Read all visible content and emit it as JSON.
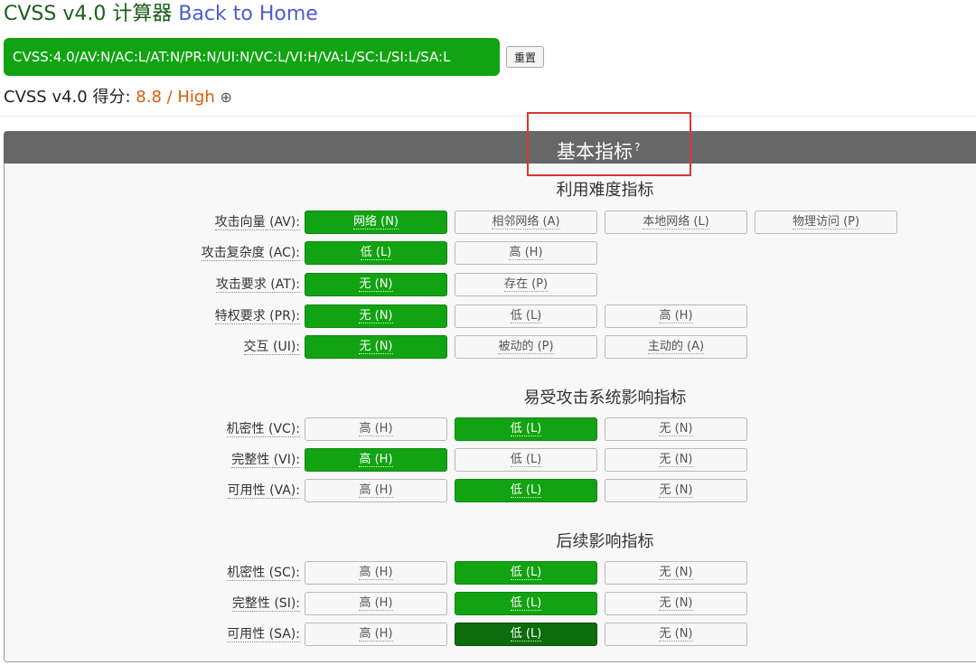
{
  "header": {
    "app_title": "CVSS v4.0 计算器",
    "home_link": "Back to Home"
  },
  "vector": {
    "string": "CVSS:4.0/AV:N/AC:L/AT:N/PR:N/UI:N/VC:L/VI:H/VA:L/SC:L/SI:L/SA:L",
    "reset_label": "重置"
  },
  "score": {
    "prefix": "CVSS v4.0 得分:",
    "value": "8.8 / High",
    "expand_symbol": "⊕"
  },
  "panel": {
    "title": "基本指标",
    "help_mark": "?"
  },
  "sections": {
    "exploitability": {
      "title": "利用难度指标",
      "metrics": {
        "av": {
          "label": "攻击向量 (AV):",
          "options": [
            "网络 (N)",
            "相邻网络 (A)",
            "本地网络 (L)",
            "物理访问 (P)"
          ],
          "selected": 0
        },
        "ac": {
          "label": "攻击复杂度 (AC):",
          "options": [
            "低 (L)",
            "高 (H)"
          ],
          "selected": 0
        },
        "at": {
          "label": "攻击要求 (AT):",
          "options": [
            "无 (N)",
            "存在 (P)"
          ],
          "selected": 0
        },
        "pr": {
          "label": "特权要求 (PR):",
          "options": [
            "无 (N)",
            "低 (L)",
            "高 (H)"
          ],
          "selected": 0
        },
        "ui": {
          "label": "交互 (UI):",
          "options": [
            "无 (N)",
            "被动的 (P)",
            "主动的 (A)"
          ],
          "selected": 0
        }
      }
    },
    "vulnerable": {
      "title": "易受攻击系统影响指标",
      "metrics": {
        "vc": {
          "label": "机密性 (VC):",
          "options": [
            "高 (H)",
            "低 (L)",
            "无 (N)"
          ],
          "selected": 1
        },
        "vi": {
          "label": "完整性 (VI):",
          "options": [
            "高 (H)",
            "低 (L)",
            "无 (N)"
          ],
          "selected": 0
        },
        "va": {
          "label": "可用性 (VA):",
          "options": [
            "高 (H)",
            "低 (L)",
            "无 (N)"
          ],
          "selected": 1
        }
      }
    },
    "subsequent": {
      "title": "后续影响指标",
      "metrics": {
        "sc": {
          "label": "机密性 (SC):",
          "options": [
            "高 (H)",
            "低 (L)",
            "无 (N)"
          ],
          "selected": 1
        },
        "si": {
          "label": "完整性 (SI):",
          "options": [
            "高 (H)",
            "低 (L)",
            "无 (N)"
          ],
          "selected": 1
        },
        "sa": {
          "label": "可用性 (SA):",
          "options": [
            "高 (H)",
            "低 (L)",
            "无 (N)"
          ],
          "selected": 1
        }
      }
    }
  },
  "colors": {
    "selected": "#12a312",
    "selected_focus": "#0b6d0b",
    "score": "#e05a00",
    "link": "#4b5bd6",
    "highlight_box": "#d93636"
  }
}
